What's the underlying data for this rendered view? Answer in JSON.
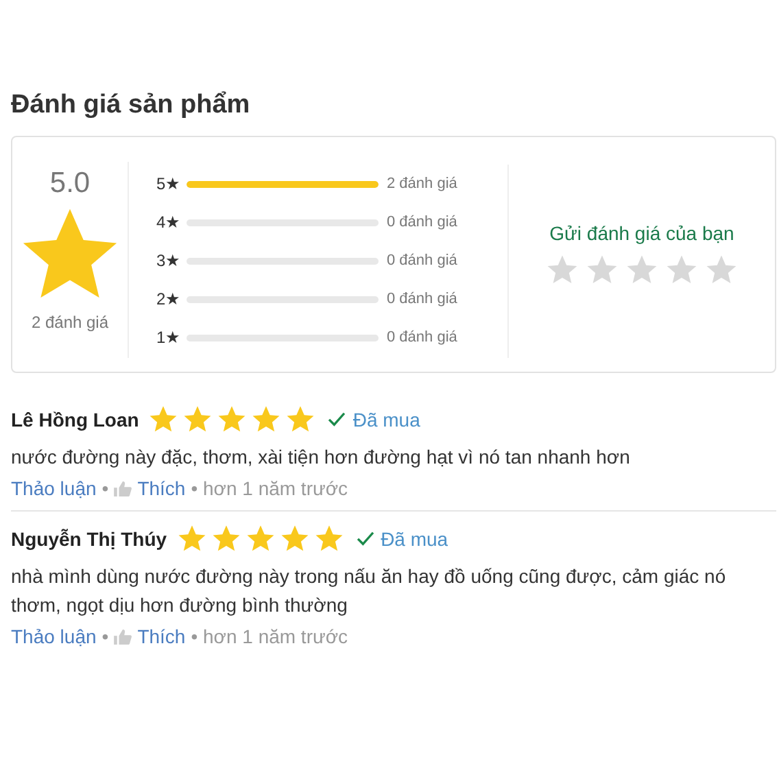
{
  "title": "Đánh giá sản phẩm",
  "summary": {
    "average": "5.0",
    "count": "2 đánh giá",
    "bars": [
      {
        "label": "5★",
        "level": 1,
        "count": "2 đánh giá"
      },
      {
        "label": "4★",
        "level": 0,
        "count": "0 đánh giá"
      },
      {
        "label": "3★",
        "level": 0,
        "count": "0 đánh giá"
      },
      {
        "label": "2★",
        "level": 0,
        "count": "0 đánh giá"
      },
      {
        "label": "1★",
        "level": 0,
        "count": "0 đánh giá"
      }
    ]
  },
  "rate_prompt": {
    "label": "Gửi đánh giá của bạn",
    "stars": 0
  },
  "reviews": [
    {
      "name": "Lê Hồng Loan",
      "stars": 5,
      "badge": "Đã mua",
      "text": "nước đường này đặc, thơm, xài tiện hơn đường hạt vì nó tan nhanh hơn",
      "discuss": "Thảo luận",
      "separator": "•",
      "like": "Thích",
      "time": "• hơn 1 năm trước"
    },
    {
      "name": "Nguyễn Thị Thúy",
      "stars": 5,
      "badge": "Đã mua",
      "text": "nhà mình dùng nước đường này trong nấu ăn hay đồ uống cũng được, cảm giác nó thơm, ngọt dịu hơn đường bình thường",
      "discuss": "Thảo luận",
      "separator": "•",
      "like": "Thích",
      "time": "• hơn 1 năm trước"
    }
  ]
}
